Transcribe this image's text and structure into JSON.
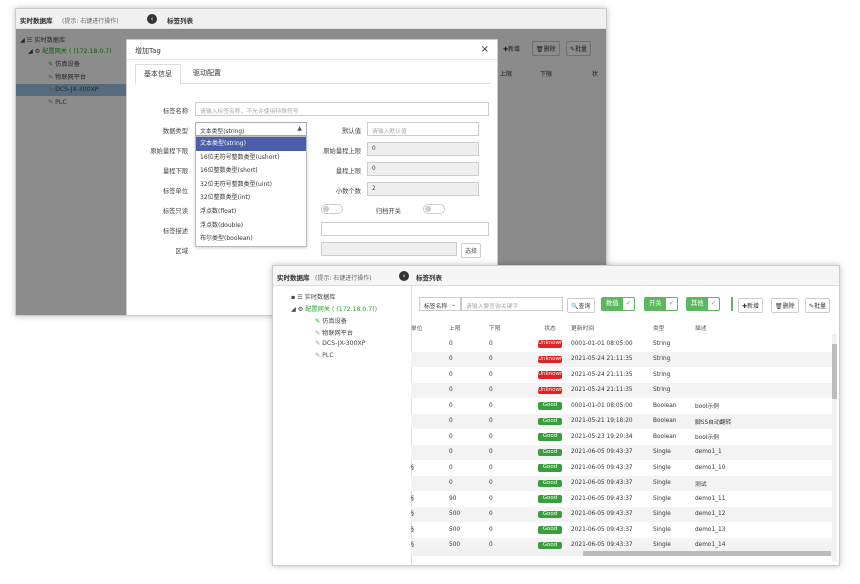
{
  "win1": {
    "title": "实时数据库",
    "hint": "(提示: 右键进行操作)",
    "list_title": "标签列表",
    "tree": [
      "实时数据库",
      "配置网关 ( (172.18.0.7)",
      "仿真设备",
      "物联网平台",
      "DCS-JX-300XP",
      "PLC"
    ],
    "bg_buttons": [
      "新增",
      "删除",
      "批量"
    ],
    "bg_headers": [
      "上限",
      "下限",
      "状"
    ],
    "modal": {
      "title": "增加Tag",
      "close": "×",
      "tabs": [
        "基本信息",
        "驱动配置"
      ],
      "labels": {
        "name": "标签名称",
        "dtype": "数据类型",
        "default": "默认值",
        "raw_low": "原始量程下限",
        "raw_high": "原始量程上限",
        "low": "量程下限",
        "high": "量程上限",
        "unit": "标签单位",
        "decimals": "小数个数",
        "readonly": "标签只读",
        "archive": "归档开关",
        "desc": "标签描述",
        "area": "区域"
      },
      "name_placeholder": "请输入标签名称，不允许使用特殊符号",
      "dtype_value": "文本类型(string)",
      "default_placeholder": "请输入默认值",
      "raw_high_value": "0",
      "high_value": "0",
      "decimals_value": "2",
      "select_btn": "选择",
      "options": [
        "文本类型(string)",
        "16位无符号整数类型(ushort)",
        "16位整数类型(short)",
        "32位无符号整数类型(uint)",
        "32位整数类型(int)",
        "浮点数(float)",
        "浮点数(double)",
        "布尔类型(boolean)"
      ]
    }
  },
  "win2": {
    "title": "实时数据库",
    "hint": "(提示: 右键进行操作)",
    "list_title": "标签列表",
    "tree": [
      "实时数据库",
      "配置网关 ( (172.18.0.7))",
      "仿真设备",
      "物联网平台",
      "DCS-JX-300XP",
      "PLC"
    ],
    "search_field": "标签名称",
    "search_placeholder": "请输入要查询关键字",
    "search_btn": "查询",
    "filters": [
      "数值",
      "开关",
      "其他"
    ],
    "actions": [
      "新增",
      "删除",
      "批量"
    ],
    "headers": [
      "单位",
      "上限",
      "下限",
      "状态",
      "更新时间",
      "类型",
      "描述"
    ],
    "rows": [
      [
        "",
        "0",
        "0",
        "Unknown",
        "0001-01-01 08:05:00",
        "String",
        ""
      ],
      [
        "",
        "0",
        "0",
        "Unknown",
        "2021-05-24 21:11:35",
        "String",
        ""
      ],
      [
        "",
        "0",
        "0",
        "Unknown",
        "2021-05-24 21:11:35",
        "String",
        ""
      ],
      [
        "",
        "0",
        "0",
        "Unknown",
        "2021-05-24 21:11:35",
        "String",
        ""
      ],
      [
        "",
        "0",
        "0",
        "Good",
        "0001-01-01 08:05:00",
        "Boolean",
        "bool示例"
      ],
      [
        "",
        "0",
        "0",
        "Good",
        "2021-05-21 19:18:20",
        "Boolean",
        "脚SS自动翻转"
      ],
      [
        "",
        "0",
        "0",
        "Good",
        "2021-05-23 19:20:34",
        "Boolean",
        "bool示例"
      ],
      [
        "",
        "0",
        "0",
        "Good",
        "2021-06-05 09:43:37",
        "Single",
        "demo1_1"
      ],
      [
        "§",
        "0",
        "0",
        "Good",
        "2021-06-05 09:43:37",
        "Single",
        "demo1_10"
      ],
      [
        "",
        "0",
        "0",
        "Good",
        "2021-06-05 09:43:37",
        "Single",
        "测试"
      ],
      [
        "§",
        "90",
        "0",
        "Good",
        "2021-06-05 09:43:37",
        "Single",
        "demo1_11"
      ],
      [
        "§",
        "500",
        "0",
        "Good",
        "2021-06-05 09:43:37",
        "Single",
        "demo1_12"
      ],
      [
        "§",
        "500",
        "0",
        "Good",
        "2021-06-05 09:43:37",
        "Single",
        "demo1_13"
      ],
      [
        "§",
        "500",
        "0",
        "Good",
        "2021-06-05 09:43:37",
        "Single",
        "demo1_14"
      ]
    ]
  }
}
